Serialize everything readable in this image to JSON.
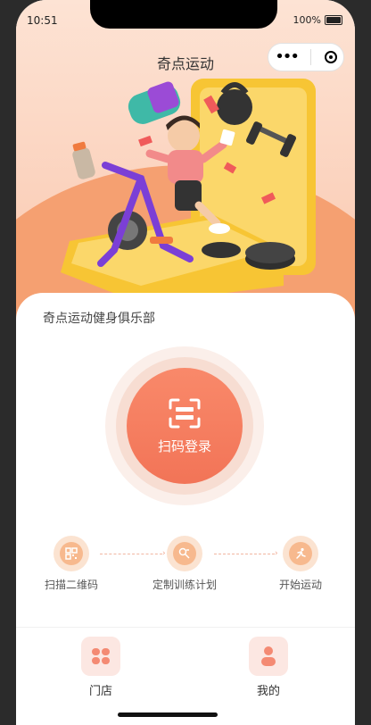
{
  "status_bar": {
    "time": "10:51",
    "battery": "100%"
  },
  "nav": {
    "title": "奇点运动"
  },
  "card": {
    "club_name": "奇点运动健身俱乐部"
  },
  "scan": {
    "label": "扫码登录"
  },
  "steps": [
    {
      "label": "扫描二维码",
      "icon": "qr-code-icon"
    },
    {
      "label": "定制训练计划",
      "icon": "plan-icon"
    },
    {
      "label": "开始运动",
      "icon": "running-icon"
    }
  ],
  "tabs": [
    {
      "label": "门店",
      "icon": "store-icon"
    },
    {
      "label": "我的",
      "icon": "user-icon"
    }
  ],
  "colors": {
    "accent": "#f27457",
    "hero_bg": "#fbd2bd",
    "hero_arc": "#f5a071",
    "step_icon": "#f7b98e"
  }
}
